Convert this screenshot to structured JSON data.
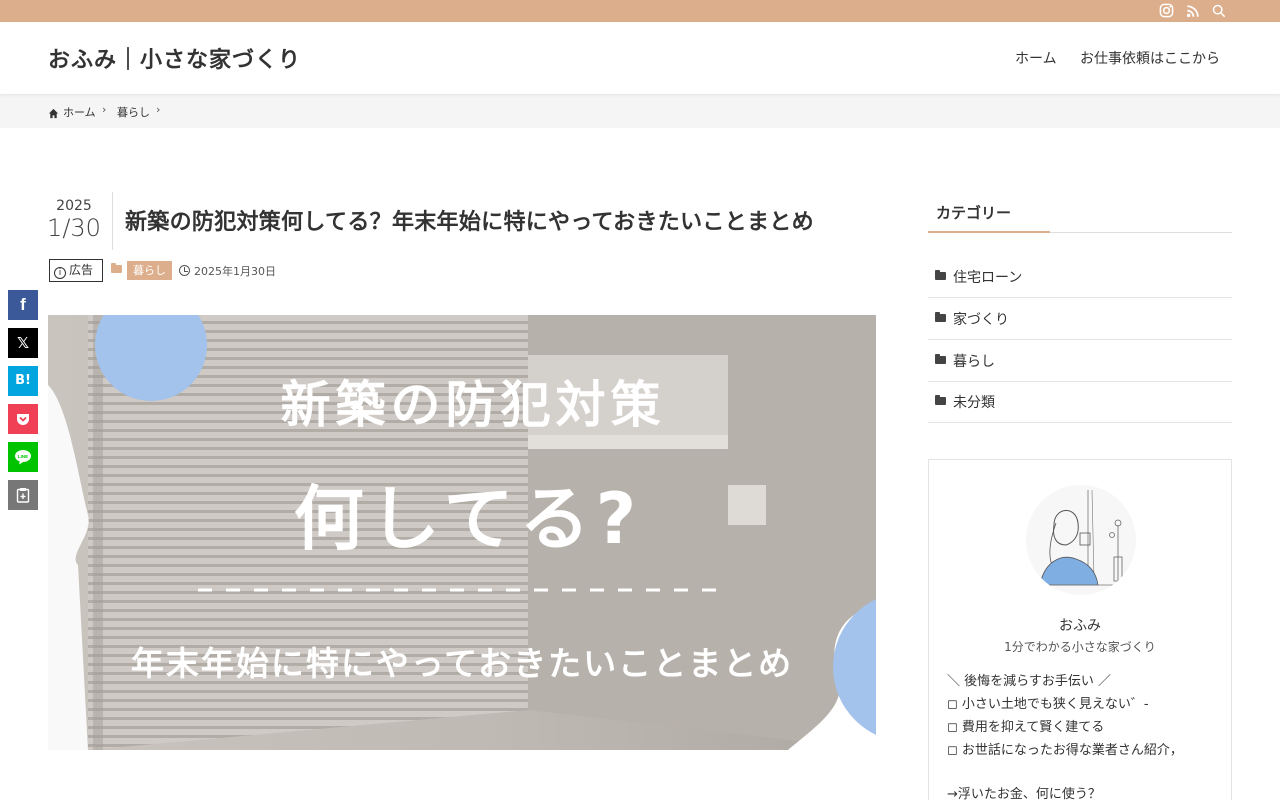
{
  "site": {
    "title": "おふみ｜小さな家づくり",
    "nav": [
      "ホーム",
      "お仕事依頼はここから"
    ],
    "topbar_icons": [
      "instagram-icon",
      "rss-icon",
      "search-icon"
    ]
  },
  "breadcrumb": {
    "home": "ホーム",
    "category": "暮らし",
    "separator": "›"
  },
  "post": {
    "date_year": "2025",
    "date_md": "1/30",
    "title": "新築の防犯対策何してる？年末年始に特にやっておきたいことまとめ",
    "ad_label": "広告",
    "category": "暮らし",
    "published": "2025年1月30日"
  },
  "eyecatch": {
    "line1": "新築の防犯対策",
    "line2": "何してる?",
    "line3": "年末年始に特にやっておきたいことまとめ"
  },
  "share_buttons": [
    {
      "label": "f",
      "color": "#3b5998"
    },
    {
      "label": "𝕏",
      "color": "#000000"
    },
    {
      "label": "B!",
      "color": "#00a4de"
    },
    {
      "label": "⌄",
      "color": "#ef4056"
    },
    {
      "label": "LINE",
      "color": "#00c300"
    },
    {
      "label": "⎘",
      "color": "#777777"
    }
  ],
  "sidebar": {
    "widget_title": "カテゴリー",
    "categories": [
      "住宅ローン",
      "家づくり",
      "暮らし",
      "未分類"
    ],
    "profile": {
      "name": "おふみ",
      "tagline": "1分でわかる小さな家づくり",
      "lines": [
        "＼ 後悔を減らすお手伝い ／",
        "◻ 小さい土地でも狭く見えない゛-",
        "◻ 費用を抑えて賢く建てる",
        "◻ お世話になったお得な業者さん紹介，",
        "→浮いたお金、何に使う？"
      ]
    }
  },
  "colors": {
    "accent": "#dcae8b",
    "circle_blue": "#a3c2ec"
  }
}
